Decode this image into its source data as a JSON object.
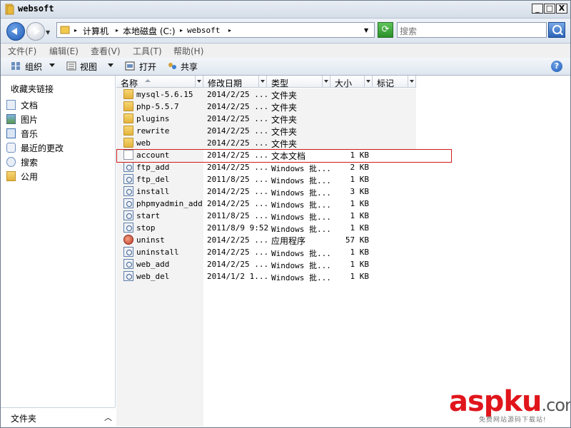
{
  "window": {
    "title": "websoft",
    "controls": [
      "_",
      "□",
      "X"
    ]
  },
  "nav": {
    "breadcrumbs": [
      "计算机",
      "本地磁盘 (C:)",
      "websoft"
    ],
    "search_placeholder": "搜索"
  },
  "menu": [
    "文件(F)",
    "编辑(E)",
    "查看(V)",
    "工具(T)",
    "帮助(H)"
  ],
  "toolbar": {
    "organize": "组织",
    "views": "视图",
    "open": "打开",
    "share": "共享",
    "help": "?"
  },
  "sidebar": {
    "heading": "收藏夹链接",
    "items": [
      {
        "label": "文档",
        "icon": "document-icon"
      },
      {
        "label": "图片",
        "icon": "picture-icon"
      },
      {
        "label": "音乐",
        "icon": "music-icon"
      },
      {
        "label": "最近的更改",
        "icon": "recent-icon"
      },
      {
        "label": "搜索",
        "icon": "search-icon"
      },
      {
        "label": "公用",
        "icon": "folder-icon"
      }
    ],
    "folders_label": "文件夹"
  },
  "columns": [
    "名称",
    "修改日期",
    "类型",
    "大小",
    "标记"
  ],
  "files": [
    {
      "name": "mysql-5.6.15",
      "date": "2014/2/25 ...",
      "type": "文件夹",
      "size": "",
      "kind": "folder"
    },
    {
      "name": "php-5.5.7",
      "date": "2014/2/25 ...",
      "type": "文件夹",
      "size": "",
      "kind": "folder"
    },
    {
      "name": "plugins",
      "date": "2014/2/25 ...",
      "type": "文件夹",
      "size": "",
      "kind": "folder"
    },
    {
      "name": "rewrite",
      "date": "2014/2/25 ...",
      "type": "文件夹",
      "size": "",
      "kind": "folder"
    },
    {
      "name": "web",
      "date": "2014/2/25 ...",
      "type": "文件夹",
      "size": "",
      "kind": "folder"
    },
    {
      "name": "account",
      "date": "2014/2/25 ...",
      "type": "文本文档",
      "size": "1 KB",
      "kind": "text"
    },
    {
      "name": "ftp_add",
      "date": "2014/2/25 ...",
      "type": "Windows 批...",
      "size": "2 KB",
      "kind": "bat"
    },
    {
      "name": "ftp_del",
      "date": "2011/8/25 ...",
      "type": "Windows 批...",
      "size": "1 KB",
      "kind": "bat"
    },
    {
      "name": "install",
      "date": "2014/2/25 ...",
      "type": "Windows 批...",
      "size": "3 KB",
      "kind": "bat"
    },
    {
      "name": "phpmyadmin_add",
      "date": "2014/2/25 ...",
      "type": "Windows 批...",
      "size": "1 KB",
      "kind": "bat"
    },
    {
      "name": "start",
      "date": "2011/8/25 ...",
      "type": "Windows 批...",
      "size": "1 KB",
      "kind": "bat"
    },
    {
      "name": "stop",
      "date": "2011/8/9 9:52",
      "type": "Windows 批...",
      "size": "1 KB",
      "kind": "bat"
    },
    {
      "name": "uninst",
      "date": "2014/2/25 ...",
      "type": "应用程序",
      "size": "57 KB",
      "kind": "exe"
    },
    {
      "name": "uninstall",
      "date": "2014/2/25 ...",
      "type": "Windows 批...",
      "size": "1 KB",
      "kind": "bat"
    },
    {
      "name": "web_add",
      "date": "2014/2/25 ...",
      "type": "Windows 批...",
      "size": "1 KB",
      "kind": "bat"
    },
    {
      "name": "web_del",
      "date": "2014/1/2 1...",
      "type": "Windows 批...",
      "size": "1 KB",
      "kind": "bat"
    }
  ],
  "highlighted_row": "account",
  "watermark": {
    "main": "aspku",
    "dot": ".com",
    "sub": "免费网站源码下载站!"
  }
}
